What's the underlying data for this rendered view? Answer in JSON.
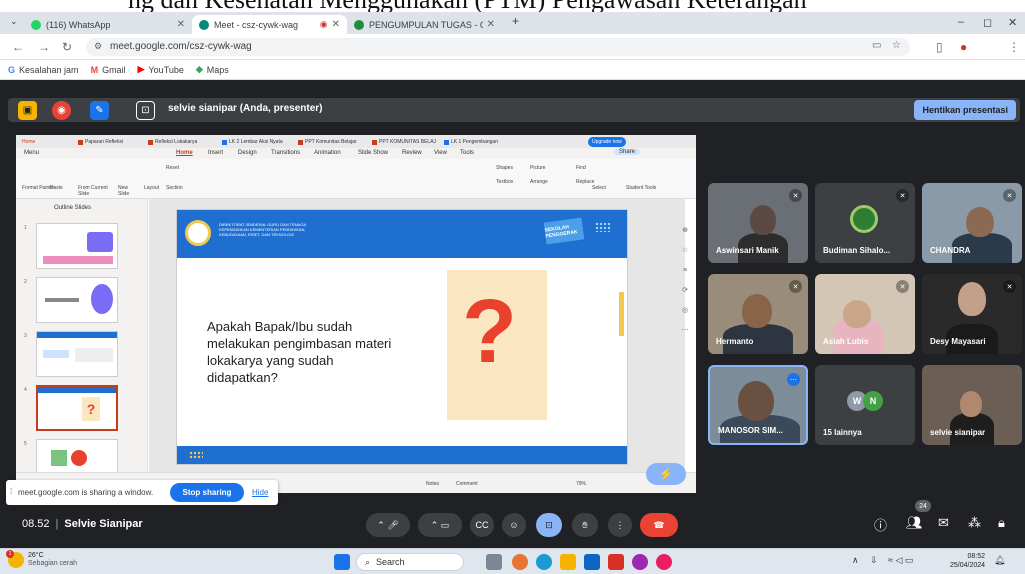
{
  "caption": {
    "text": "ng dan Kesehatan Menggunakan (PTM) Pengawasan Keterangan"
  },
  "browser": {
    "tabs": [
      {
        "label": "(116) WhatsApp",
        "color": "#25d366"
      },
      {
        "label": "Meet - csz-cywk-wag",
        "color": "#00897b"
      },
      {
        "label": "PENGUMPULAN TUGAS - Goo",
        "color": "#1e8e3e"
      }
    ],
    "new_tab": "+",
    "window_controls": [
      "–",
      "◻",
      "✕"
    ],
    "url": "meet.google.com/csz-cywk-wag",
    "bookmarks": [
      {
        "label": "Kesalahan jam",
        "icon": "G",
        "color": "#4285f4"
      },
      {
        "label": "Gmail",
        "icon": "M",
        "color": "#ea4335"
      },
      {
        "label": "YouTube",
        "icon": "▶",
        "color": "#ff0000"
      },
      {
        "label": "Maps",
        "icon": "◆",
        "color": "#34a853"
      }
    ]
  },
  "presenting": {
    "text": "selvie sianipar (Anda, presenter)",
    "stop_label": "Hentikan presentasi"
  },
  "ppt": {
    "tabs": [
      "Home",
      "Paparan Refleksi",
      "Refleksi Lokakarya",
      "LK 2 Lembar Aksi Nyata",
      "PPT Komunitas Belajar",
      "PPT KOMUNITAS BELAJ",
      "LK 1 Pengembangan"
    ],
    "upgrade_label": "Upgrade now",
    "menu": [
      "Menu",
      "Home",
      "Insert",
      "Design",
      "Transitions",
      "Animation",
      "Slide Show",
      "Review",
      "View",
      "Tools"
    ],
    "share_label": "Share",
    "ribbon": [
      "Format Painter",
      "Paste",
      "From Current Slide",
      "New Slide",
      "Layout",
      "Section",
      "Reset",
      "Shapes",
      "Picture",
      "Find",
      "Textbox",
      "Arrange",
      "Replace",
      "Select",
      "Student Tools"
    ],
    "outline_tabs": "Outline  Slides",
    "slide_numbers": [
      "1",
      "2",
      "3",
      "4",
      "5"
    ],
    "question": "Apakah Bapak/Ibu sudah melakukan pengimbasan materi lokakarya yang sudah didapatkan?",
    "org_text": "DIREKTORAT JENDERAL GURU DAN TENAGA KEPENDIDIKAN KEMENTERIAN PENDIDIKAN, KEBUDAYAAN, RISET, DAN TEKNOLOGI",
    "badge": "SEKOLAH PENGGERAK",
    "notes": "Notes",
    "comment": "Comment",
    "zoom": "79%"
  },
  "sharing": {
    "text": "meet.google.com is sharing a window.",
    "stop_label": "Stop sharing",
    "hide_label": "Hide"
  },
  "participants": [
    {
      "name": "Aswinsari Manik",
      "bg": "#6a6f75",
      "skin": "#5b4a42"
    },
    {
      "name": "Budiman Sihalo...",
      "bg": "#3c4043",
      "skin": "#7a6a5a"
    },
    {
      "name": "CHANDRA",
      "bg": "#8a9aa8",
      "skin": "#8a6a52"
    },
    {
      "name": "Hermanto",
      "bg": "#9a8c7a",
      "skin": "#8a6448"
    },
    {
      "name": "Asiah Lubis",
      "bg": "#d4c6b4",
      "skin": "#c9a58a"
    },
    {
      "name": "Desy Mayasari",
      "bg": "#2a2a2a",
      "skin": "#c2a08a"
    },
    {
      "name": "MANOSOR SIM...",
      "bg": "#7d8c99",
      "skin": "#6a5040"
    },
    {
      "name": "15 lainnya",
      "bg": "#3c4043",
      "skin": ""
    },
    {
      "name": "selvie sianipar",
      "bg": "#6b5f55",
      "skin": "#b08870"
    }
  ],
  "others_avatars": [
    "W",
    "N"
  ],
  "meeting": {
    "time": "08.52",
    "name": "Selvie Sianipar",
    "people_count": "24"
  },
  "taskbar": {
    "temp": "26°C",
    "weather": "Sebagian cerah",
    "search": "Search",
    "time": "08:52",
    "date": "25/04/2024"
  }
}
